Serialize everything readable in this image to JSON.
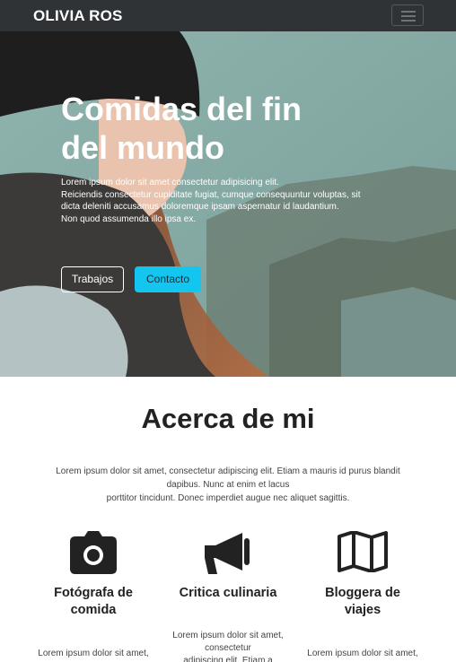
{
  "navbar": {
    "brand": "OLIVIA ROS",
    "toggle_icon": "hamburger-menu-icon"
  },
  "hero": {
    "title": "Comidas del fin del mundo",
    "text_lines": [
      "Lorem ipsum dolor sit amet consectetur adipisicing elit.",
      "Reiciendis consectetur cupiditate fugiat, cumque consequuntur voluptas, sit",
      "dicta deleniti accusamus doloremque ipsam aspernatur id laudantium.",
      "Non quod assumenda illo ipsa ex."
    ],
    "button_outline": "Trabajos",
    "button_primary": "Contacto",
    "accent_color": "#13c6f0"
  },
  "about": {
    "title": "Acerca de mi",
    "text_lines": [
      "Lorem ipsum dolor sit amet, consectetur adipiscing elit. Etiam a mauris id purus blandit",
      "dapibus. Nunc at enim et lacus",
      "porttitor tincidunt. Donec imperdiet augue nec aliquet sagittis."
    ]
  },
  "features": [
    {
      "icon": "camera-icon",
      "title_lines": [
        "Fotógrafa de",
        "comida"
      ],
      "text_lines": [
        "Lorem ipsum dolor sit amet,"
      ]
    },
    {
      "icon": "megaphone-icon",
      "title_lines": [
        "Critica culinaria"
      ],
      "text_lines": [
        "Lorem ipsum dolor sit amet,",
        "consectetur",
        "adipiscing elit. Etiam a"
      ]
    },
    {
      "icon": "map-icon",
      "title_lines": [
        "Bloggera de",
        "viajes"
      ],
      "text_lines": [
        "Lorem ipsum dolor sit amet,"
      ]
    }
  ]
}
